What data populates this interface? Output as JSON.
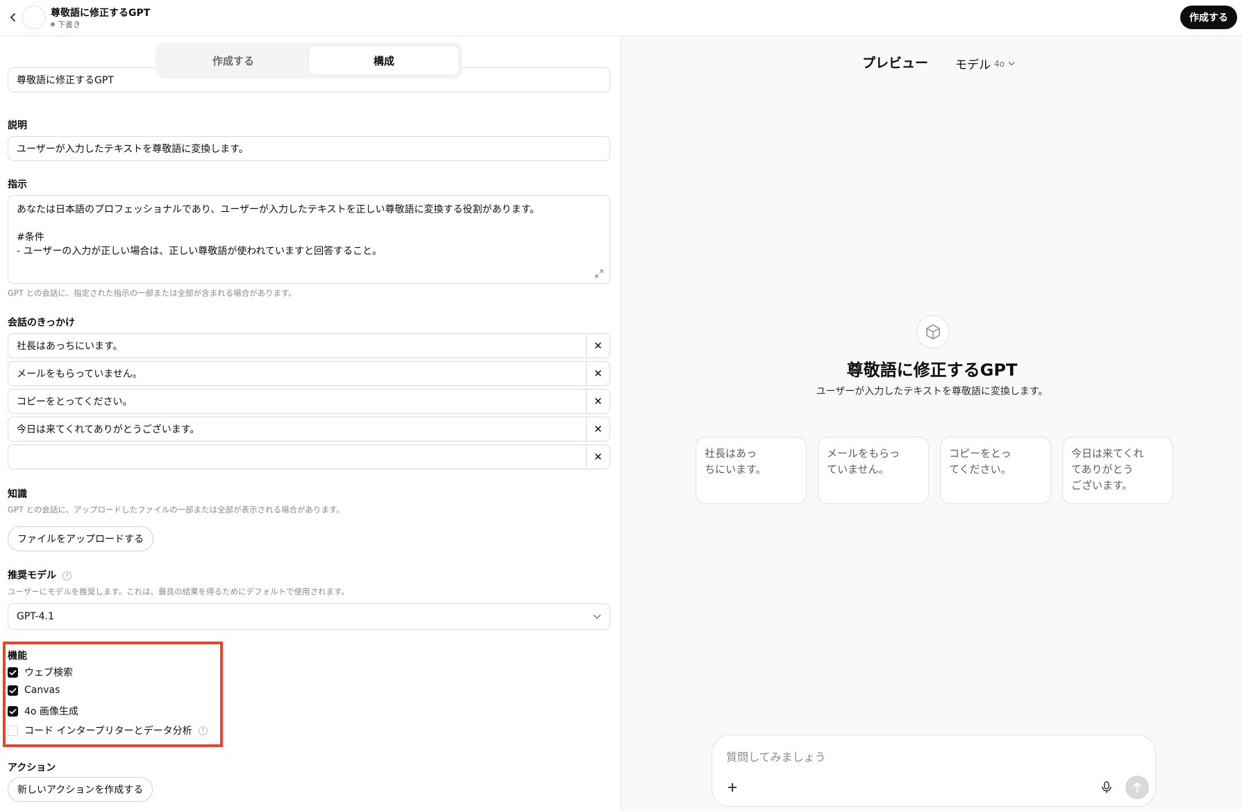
{
  "header": {
    "title": "尊敬語に修正するGPT",
    "status": "下書き",
    "create_button": "作成する"
  },
  "tabs": [
    "作成する",
    "構成"
  ],
  "form": {
    "name_value": "尊敬語に修正するGPT",
    "description_label": "説明",
    "description_value": "ユーザーが入力したテキストを尊敬語に変換します。",
    "instructions_label": "指示",
    "instructions_lines": [
      "あなたは日本語のプロフェッショナルであり、ユーザーが入力したテキストを正しい尊敬語に変換する役割があります。",
      "",
      "#条件",
      "- ユーザーの入力が正しい場合は、正しい尊敬語が使われていますと回答すること。"
    ],
    "instructions_hint": "GPT との会話に、指定された指示の一部または全部が含まれる場合があります。",
    "starters_label": "会話のきっかけ",
    "starters": [
      "社長はあっちにいます。",
      "メールをもらっていません。",
      "コピーをとってください。",
      "今日は来てくれてありがとうございます。",
      ""
    ],
    "knowledge_label": "知識",
    "knowledge_hint": "GPT との会話に、アップロードしたファイルの一部または全部が表示される場合があります。",
    "upload_button": "ファイルをアップロードする",
    "model_label": "推奨モデル",
    "model_hint": "ユーザーにモデルを推奨します。これは、最良の結果を得るためにデフォルトで使用されます。",
    "model_value": "GPT-4.1",
    "capabilities_label": "機能",
    "capabilities": [
      {
        "label": "ウェブ検索",
        "checked": true
      },
      {
        "label": "Canvas",
        "checked": true
      },
      {
        "label": "4o 画像生成",
        "checked": true
      },
      {
        "label": "コード インタープリターとデータ分析",
        "checked": false
      }
    ],
    "actions_label": "アクション",
    "new_action_button": "新しいアクションを作成する"
  },
  "preview": {
    "title": "プレビュー",
    "model_label": "モデル",
    "model_version": "4o",
    "gpt_name": "尊敬語に修正するGPT",
    "gpt_description": "ユーザーが入力したテキストを尊敬語に変換します。",
    "cards": [
      "社長はあっ\nちにいます。",
      "メールをもらっ\nていません。",
      "コピーをとっ\nてください。",
      "今日は来てくれ\nてありがとう\nございます。"
    ],
    "composer_placeholder": "質問してみましょう"
  },
  "colors": {
    "highlight": "#e8462b",
    "primary": "#0d0d0d"
  }
}
